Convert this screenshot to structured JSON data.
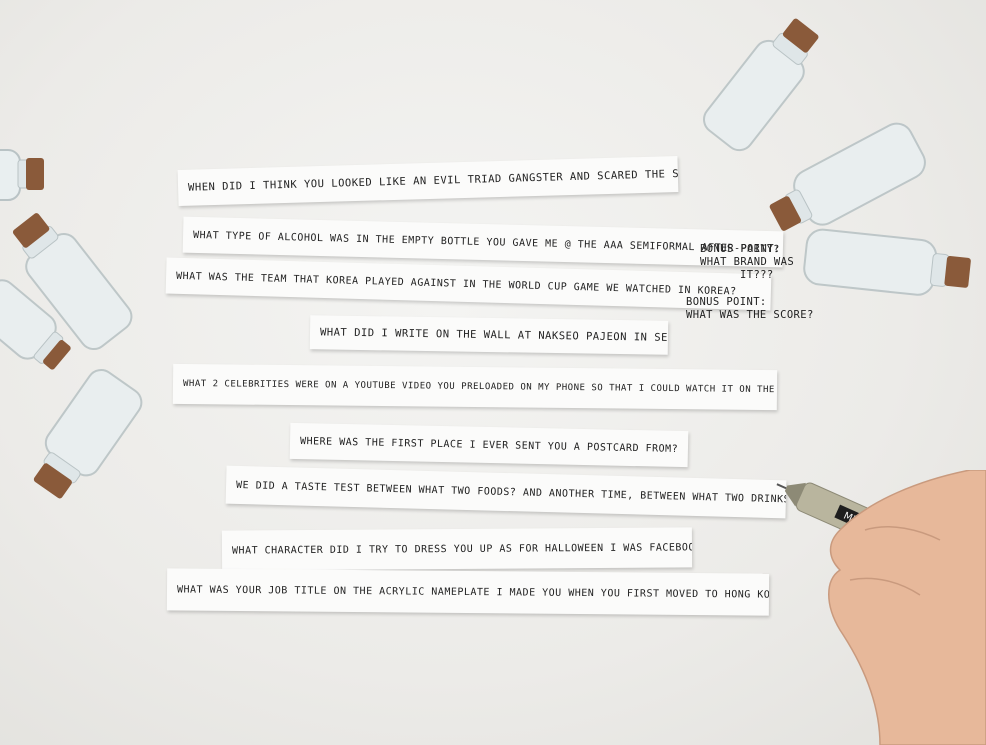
{
  "strips": [
    "WHEN DID I THINK YOU LOOKED LIKE AN EVIL TRIAD GANGSTER AND SCARED THE SHIT OUT OF ME?",
    "WHAT TYPE OF ALCOHOL WAS IN THE EMPTY BOTTLE YOU GAVE ME @ THE AAA SEMIFORMAL AFTER-PARTY?",
    "WHAT WAS THE TEAM THAT KOREA PLAYED AGAINST IN THE WORLD CUP GAME WE WATCHED IN KOREA?",
    "WHAT DID I WRITE ON THE WALL AT NAKSEO PAJEON IN SEOUL?",
    "WHAT 2 CELEBRITIES WERE ON A YOUTUBE VIDEO YOU PRELOADED ON MY PHONE SO THAT I COULD WATCH IT ON THE BUS?",
    "WHERE WAS THE FIRST PLACE I EVER SENT YOU A POSTCARD FROM?",
    "WE DID A TASTE TEST BETWEEN WHAT TWO FOODS? AND ANOTHER TIME, BETWEEN WHAT TWO DRINKS?",
    "WHAT CHARACTER DID I TRY TO DRESS YOU UP AS FOR HALLOWEEN I WAS FACEBOOK FAIRY?",
    "WHAT WAS YOUR JOB TITLE ON THE ACRYLIC NAMEPLATE I MADE YOU WHEN YOU FIRST MOVED TO HONG KONG?"
  ],
  "bonus_notes": {
    "brand_line1": "BONUS POINT:",
    "brand_line2": "WHAT BRAND WAS",
    "brand_line3": "IT???",
    "score_line1": "BONUS POINT:",
    "score_line2": "WHAT WAS THE SCORE?"
  },
  "pen_label": "MICRON",
  "colors": {
    "paper": "#fbfbfa",
    "background": "#ecebe8",
    "cork": "#8a5a3a",
    "glass": "#dfe6e8",
    "skin": "#e7b89a",
    "pen": "#b9b59e"
  }
}
